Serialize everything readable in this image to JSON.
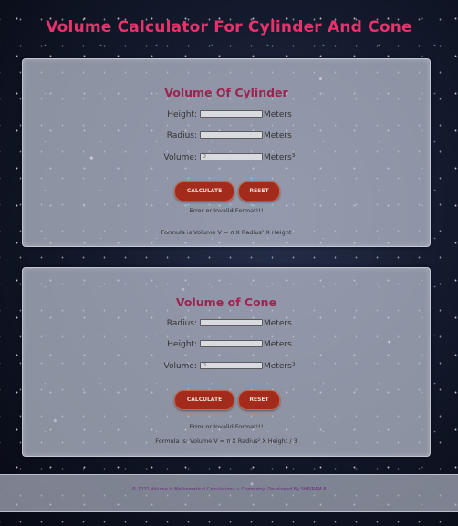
{
  "page": {
    "title": "Volume Calculator For Cylinder And Cone"
  },
  "cylinder": {
    "title": "Volume Of Cylinder",
    "height_label": "Height:",
    "height_value": "",
    "height_unit": "Meters",
    "radius_label": "Radius:",
    "radius_value": "",
    "radius_unit": "Meters",
    "volume_label": "Volume:",
    "volume_value": "0",
    "volume_unit": "Meters³",
    "calculate_label": "CALCULATE",
    "reset_label": "RESET",
    "error_text": "Error or Invalid Format!!!",
    "formula_text": "Formula is Volume V = π X Radius² X Height"
  },
  "cone": {
    "title": "Volume of Cone",
    "radius_label": "Radius:",
    "radius_value": "",
    "radius_unit": "Meters",
    "height_label": "Height:",
    "height_value": "",
    "height_unit": "Meters",
    "volume_label": "Volume:",
    "volume_value": "0",
    "volume_unit": "Meters³",
    "calculate_label": "CALCULATE",
    "reset_label": "RESET",
    "error_text": "Error or Invalid Format!!!",
    "formula_text": "Formula is: Volume V = π X Radius² X Height / 3"
  },
  "footer": {
    "text": "© 2022 Volume is Mathematical Calculations ~ Chemistry, Developed By SHRIRAM R"
  },
  "colors": {
    "title": "#e6336c",
    "card_title": "#9a2550",
    "button": "#a32b1c",
    "footer_text": "#6a2a7a"
  }
}
